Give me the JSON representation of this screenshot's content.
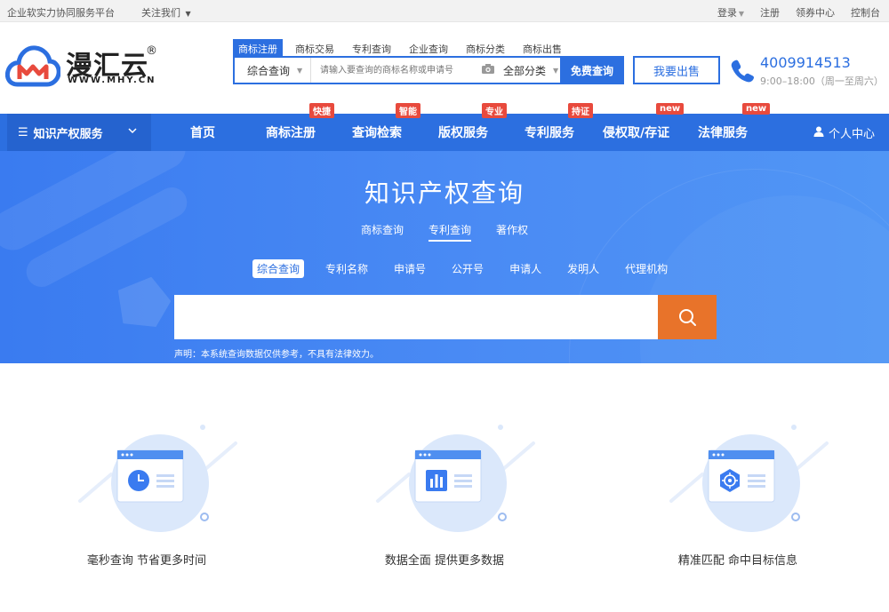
{
  "topbar": {
    "slogan": "企业软实力协同服务平台",
    "follow": "关注我们",
    "login": "登录",
    "register": "注册",
    "coupon": "领券中心",
    "console": "控制台"
  },
  "logo": {
    "brand": "漫汇云",
    "reg": "®",
    "domain": "WWW.MHY.CN"
  },
  "header_search": {
    "tabs": [
      "商标注册",
      "商标交易",
      "专利查询",
      "企业查询",
      "商标分类",
      "商标出售"
    ],
    "active_tab": "商标注册",
    "type_select": "综合查询",
    "placeholder": "请输入要查询的商标名称或申请号",
    "category_select": "全部分类",
    "button": "免费查询"
  },
  "sell_button": "我要出售",
  "contact": {
    "phone": "4009914513",
    "hours": "9:00–18:00（周一至周六）"
  },
  "nav": {
    "category": "知识产权服务",
    "items": [
      {
        "label": "首页",
        "badge": ""
      },
      {
        "label": "商标注册",
        "badge": "快捷"
      },
      {
        "label": "查询检索",
        "badge": "智能"
      },
      {
        "label": "版权服务",
        "badge": "专业"
      },
      {
        "label": "专利服务",
        "badge": "持证"
      },
      {
        "label": "侵权取/存证",
        "badge": "new"
      },
      {
        "label": "法律服务",
        "badge": "new"
      }
    ],
    "personal": "个人中心"
  },
  "hero": {
    "title": "知识产权查询",
    "tabs": [
      "商标查询",
      "专利查询",
      "著作权"
    ],
    "active_tab": "专利查询",
    "subtabs": [
      "综合查询",
      "专利名称",
      "申请号",
      "公开号",
      "申请人",
      "发明人",
      "代理机构"
    ],
    "active_subtab": "综合查询",
    "search_value": "",
    "disclaimer": "声明：本系统查询数据仅供参考，不具有法律效力。"
  },
  "features": [
    {
      "caption": "毫秒查询 节省更多时间",
      "icon": "clock-icon"
    },
    {
      "caption": "数据全面 提供更多数据",
      "icon": "bar-chart-icon"
    },
    {
      "caption": "精准匹配 命中目标信息",
      "icon": "target-icon"
    }
  ],
  "colors": {
    "primary": "#2c6fe0",
    "accent_orange": "#e8732a",
    "badge_red": "#e84a3d"
  }
}
